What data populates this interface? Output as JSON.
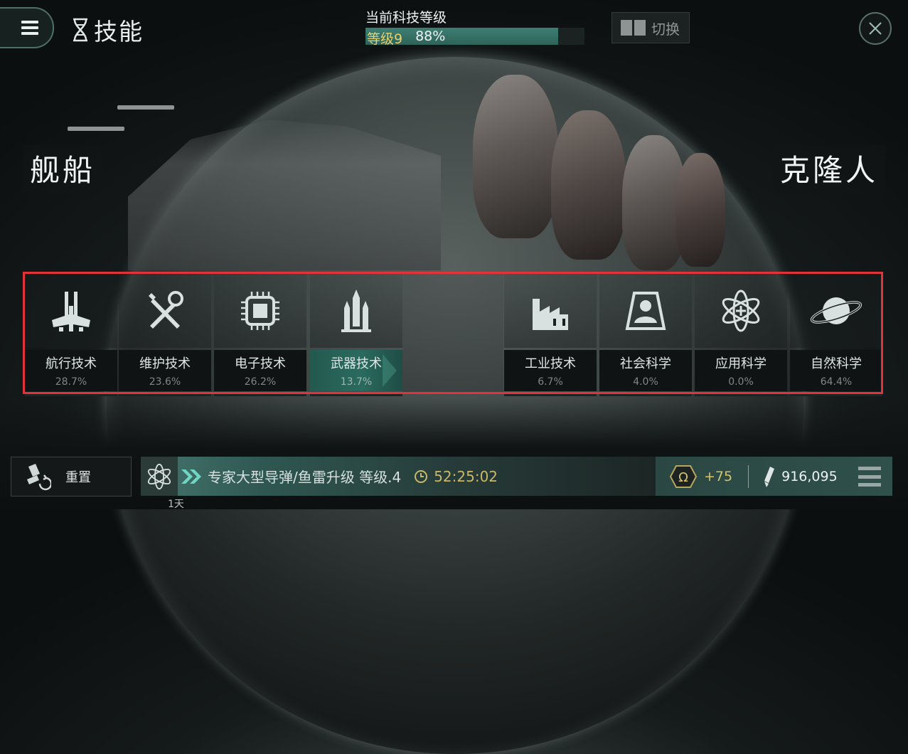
{
  "header": {
    "page_title": "技能",
    "tech_level_label": "当前科技等级",
    "tech_level_value": "等级9",
    "tech_level_percent": "88%",
    "tech_level_progress": 0.88,
    "switch_label": "切换"
  },
  "sides": {
    "left": "舰船",
    "right": "克隆人"
  },
  "skills": [
    {
      "name": "航行技术",
      "percent": "28.7%",
      "icon": "ship-icon",
      "active": false
    },
    {
      "name": "维护技术",
      "percent": "23.6%",
      "icon": "wrench-screwdriver-icon",
      "active": false
    },
    {
      "name": "电子技术",
      "percent": "26.2%",
      "icon": "chip-icon",
      "active": false
    },
    {
      "name": "武器技术",
      "percent": "13.7%",
      "icon": "missiles-icon",
      "active": true
    },
    {
      "name": "工业技术",
      "percent": "6.7%",
      "icon": "factory-icon",
      "active": false
    },
    {
      "name": "社会科学",
      "percent": "4.0%",
      "icon": "person-icon",
      "active": false
    },
    {
      "name": "应用科学",
      "percent": "0.0%",
      "icon": "atom-icon",
      "active": false
    },
    {
      "name": "自然科学",
      "percent": "64.4%",
      "icon": "planet-icon",
      "active": false
    }
  ],
  "bottom": {
    "reset_label": "重置",
    "training_skill": "专家大型导弹/鱼雷升级 等级.4",
    "training_time": "52:25:02",
    "queue_days": "1天",
    "omega_bonus": "+75",
    "skill_points": "916,095"
  },
  "colors": {
    "accent": "#2f6b5f",
    "gold": "#d8c56b",
    "highlight_frame": "#e0343a"
  }
}
